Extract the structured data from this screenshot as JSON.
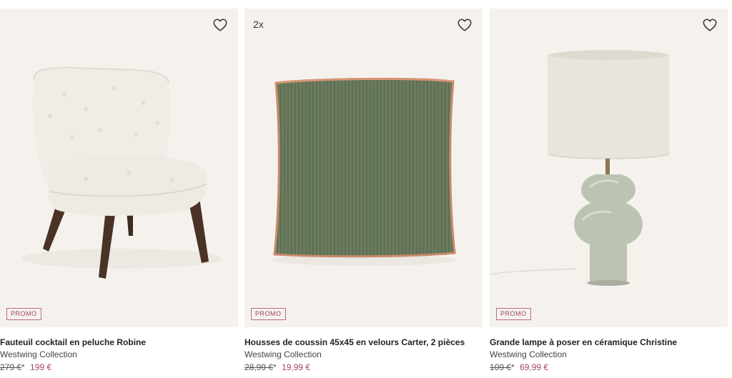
{
  "products": [
    {
      "title": "Fauteuil cocktail en peluche Robine",
      "brand": "Westwing Collection",
      "old_price": "279 €",
      "asterisk": "*",
      "new_price": "199 €",
      "badge": "PROMO",
      "quantity": "",
      "wishlist_icon": "heart-outline-icon"
    },
    {
      "title": "Housses de coussin 45x45 en velours Carter, 2 pièces",
      "brand": "Westwing Collection",
      "old_price": "28,99 €",
      "asterisk": "*",
      "new_price": "19,99 €",
      "badge": "PROMO",
      "quantity": "2x",
      "wishlist_icon": "heart-outline-icon"
    },
    {
      "title": "Grande lampe à poser en céramique Christine",
      "brand": "Westwing Collection",
      "old_price": "109 €",
      "asterisk": "*",
      "new_price": "69,99 €",
      "badge": "PROMO",
      "quantity": "",
      "wishlist_icon": "heart-outline-icon"
    }
  ],
  "colors": {
    "promo": "#a3465f",
    "card_background": "#f5f2ee"
  }
}
